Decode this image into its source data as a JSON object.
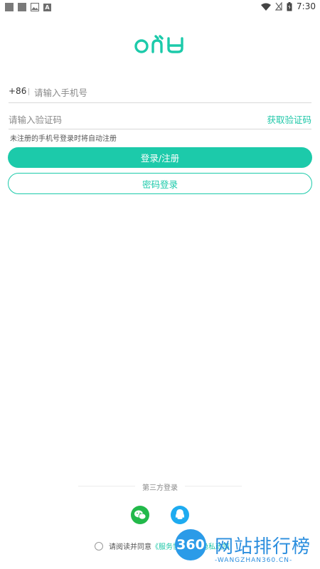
{
  "status_bar": {
    "time": "7:30",
    "notif_letter": "A"
  },
  "app": {
    "brand_color": "#1ccaaa"
  },
  "login": {
    "phone_prefix": "+86",
    "phone_placeholder": "请输入手机号",
    "code_placeholder": "请输入验证码",
    "get_code_label": "获取验证码",
    "hint": "未注册的手机号登录时将自动注册",
    "primary_button": "登录/注册",
    "password_login_button": "密码登录"
  },
  "third_party": {
    "title": "第三方登录",
    "providers": [
      "wechat",
      "qq"
    ]
  },
  "agreement": {
    "prefix": "请阅读并同意",
    "link_text": "《服务协议》及隐私政策"
  },
  "watermark": {
    "number": "360",
    "name": "网站排行榜",
    "sub": "-WANGZHAN360.CN-"
  }
}
